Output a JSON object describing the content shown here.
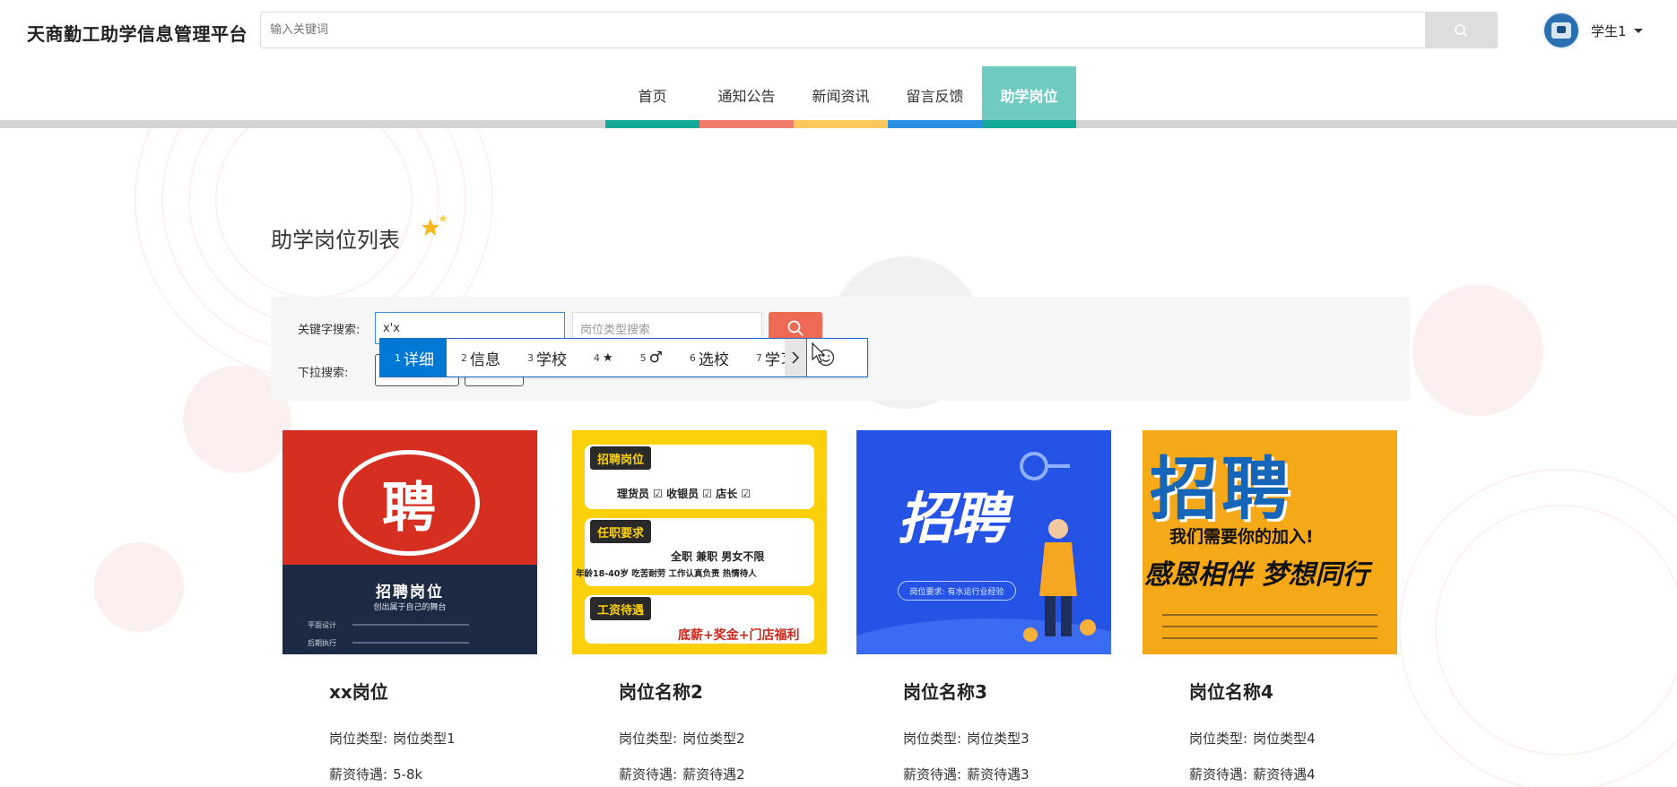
{
  "header": {
    "brand": "天商勤工助学信息管理平台",
    "search_placeholder": "输入关键词",
    "user_name": "学生1"
  },
  "nav": {
    "items": [
      {
        "label": "首页",
        "color": "#15a99a"
      },
      {
        "label": "通知公告",
        "color": "#f07c6c"
      },
      {
        "label": "新闻资讯",
        "color": "#fdc95d"
      },
      {
        "label": "留言反馈",
        "color": "#2a8fe0"
      },
      {
        "label": "助学岗位",
        "color": "#15a99a",
        "active": true
      }
    ]
  },
  "main": {
    "title": "助学岗位列表",
    "filter": {
      "keyword_label": "关键字搜索:",
      "keyword_value": "x'x",
      "type_placeholder": "岗位类型搜索",
      "dropdown_label": "下拉搜索:"
    },
    "ime": {
      "candidates": [
        {
          "num": "1",
          "text": "详细"
        },
        {
          "num": "2",
          "text": "信息"
        },
        {
          "num": "3",
          "text": "学校"
        },
        {
          "num": "4",
          "text": "★"
        },
        {
          "num": "5",
          "text": "♂"
        },
        {
          "num": "6",
          "text": "选校"
        },
        {
          "num": "7",
          "text": "学习"
        }
      ]
    },
    "cards": [
      {
        "name": "xx岗位",
        "type_label": "岗位类型:",
        "type": "岗位类型1",
        "salary_label": "薪资待遇:",
        "salary": "5-8k"
      },
      {
        "name": "岗位名称2",
        "type_label": "岗位类型:",
        "type": "岗位类型2",
        "salary_label": "薪资待遇:",
        "salary": "薪资待遇2"
      },
      {
        "name": "岗位名称3",
        "type_label": "岗位类型:",
        "type": "岗位类型3",
        "salary_label": "薪资待遇:",
        "salary": "薪资待遇3"
      },
      {
        "name": "岗位名称4",
        "type_label": "岗位类型:",
        "type": "岗位类型4",
        "salary_label": "薪资待遇:",
        "salary": "薪资待遇4"
      }
    ],
    "posters": {
      "p1_char": "聘",
      "p1_title": "招聘岗位",
      "p1_sub": "创出属于自己的舞台",
      "p1_line1": "平面设计",
      "p1_line2": "后期执行",
      "p2_tag1": "招聘岗位",
      "p2_roles": "理货员 ☑ 收银员 ☑ 店长 ☑",
      "p2_tag2": "任职要求",
      "p2_req1": "全职  兼职  男女不限",
      "p2_req2": "年龄18-40岁 吃苦耐劳 工作认真负责 热情待人",
      "p2_tag3": "工资待遇",
      "p2_pay": "底薪+奖金+门店福利",
      "p3_big": "招聘",
      "p3_pill": "岗位要求: 有水运行业经验",
      "p4_big": "招聘",
      "p4_slogan": "我们需要你的加入!",
      "p4_cursive": "感恩相伴 梦想同行"
    }
  }
}
